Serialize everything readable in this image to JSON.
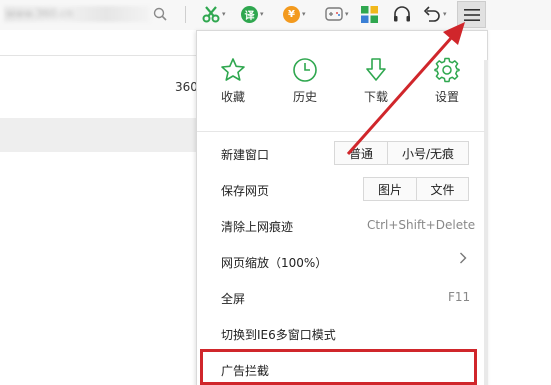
{
  "toolbar": {
    "blurred_text": "www.360.cn",
    "translate_glyph": "译",
    "coupon_glyph": "¥",
    "dropdown_caret": "▾"
  },
  "page": {
    "partial_text": "360"
  },
  "menu": {
    "quick": [
      {
        "label": "收藏",
        "icon": "star-icon"
      },
      {
        "label": "历史",
        "icon": "clock-icon"
      },
      {
        "label": "下载",
        "icon": "download-arrow-icon"
      },
      {
        "label": "设置",
        "icon": "gear-icon"
      }
    ],
    "new_window": {
      "label": "新建窗口",
      "normal": "普通",
      "incognito": "小号/无痕"
    },
    "save_page": {
      "label": "保存网页",
      "image": "图片",
      "file": "文件"
    },
    "clear_history": {
      "label": "清除上网痕迹",
      "shortcut": "Ctrl+Shift+Delete"
    },
    "zoom": {
      "label": "网页缩放（100%）"
    },
    "fullscreen": {
      "label": "全屏",
      "shortcut": "F11"
    },
    "ie6_mode": {
      "label": "切换到IE6多窗口模式"
    },
    "ad_block": {
      "label": "广告拦截"
    }
  },
  "colors": {
    "accent_green": "#2fa74f",
    "coupon_orange": "#f39a1e",
    "annotation_red": "#d0262b"
  }
}
